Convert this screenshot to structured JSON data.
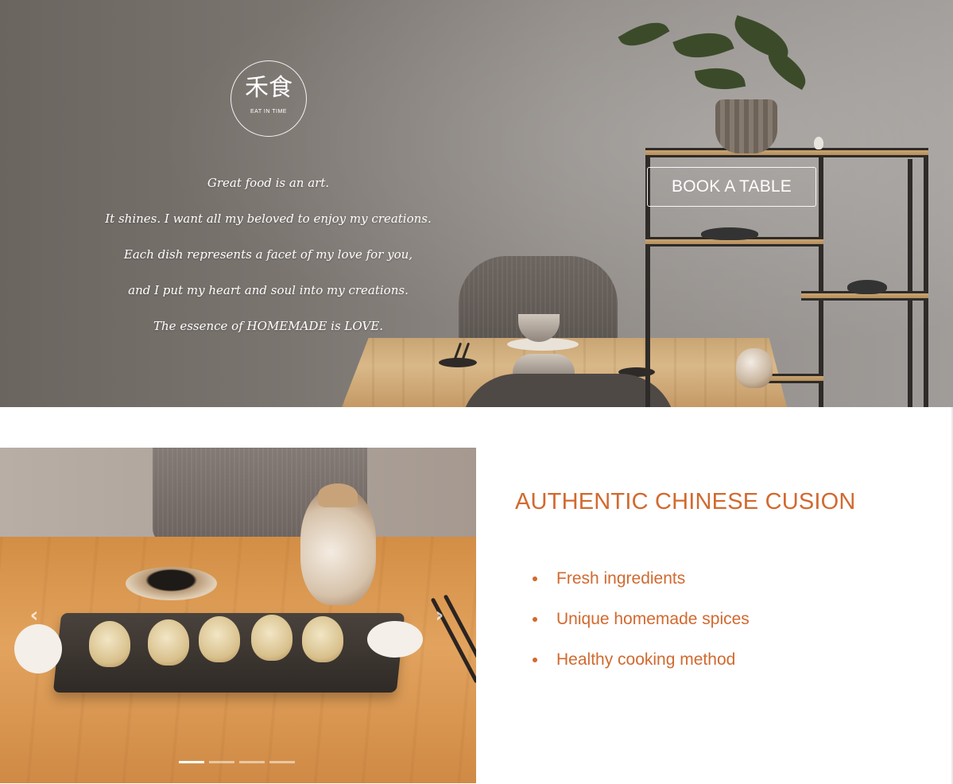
{
  "logo": {
    "glyphs": "禾食",
    "subtitle": "EAT IN TIME"
  },
  "hero": {
    "tagline": [
      "Great food is an art.",
      "It shines. I want all my beloved to enjoy my creations.",
      "Each dish represents a facet of my love for you,",
      "and I put my heart and soul into my creations.",
      "The essence of HOMEMADE is LOVE."
    ],
    "cta_label": "BOOK A TABLE"
  },
  "carousel": {
    "prev_icon": "chevron-left-icon",
    "next_icon": "chevron-right-icon",
    "slide_count": 4,
    "active_index": 0
  },
  "features": {
    "title": "AUTHENTIC CHINESE CUSION",
    "items": [
      "Fresh ingredients",
      "Unique homemade spices",
      "Healthy cooking method"
    ]
  },
  "colors": {
    "accent": "#d2692f",
    "hero_text": "#ffffff"
  }
}
